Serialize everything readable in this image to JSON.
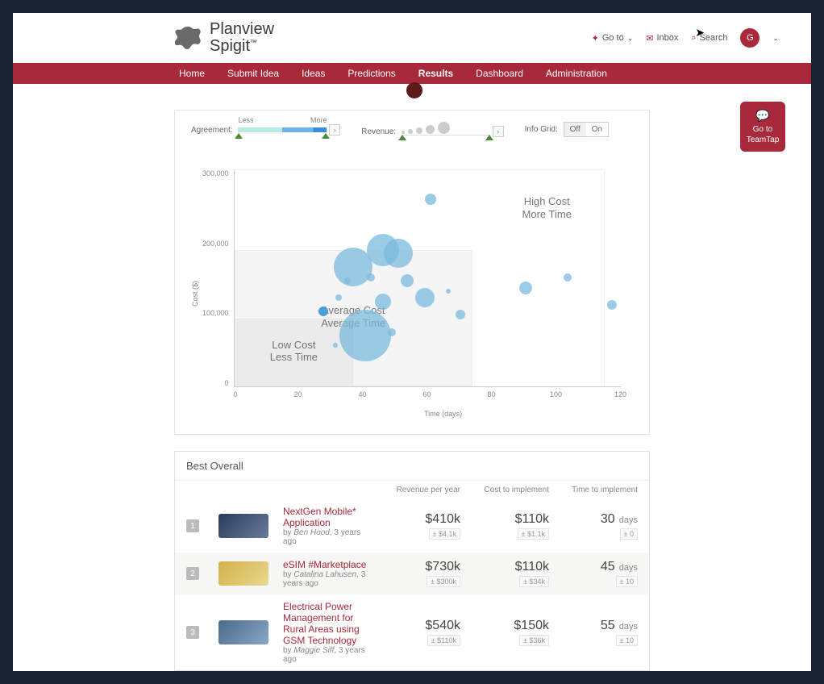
{
  "brand": {
    "line1": "Planview",
    "line2": "Spigit",
    "tm": "™"
  },
  "top": {
    "goto": "Go to",
    "inbox": "Inbox",
    "search": "Search",
    "avatar": "G"
  },
  "nav": {
    "items": [
      "Home",
      "Submit Idea",
      "Ideas",
      "Predictions",
      "Results",
      "Dashboard",
      "Administration"
    ],
    "active": 4
  },
  "controls": {
    "agreement_label": "Agreement:",
    "agreement_less": "Less",
    "agreement_more": "More",
    "revenue_label": "Revenue:",
    "infogrid_label": "Info Grid:",
    "off": "Off",
    "on": "On"
  },
  "side_button": {
    "line1": "Go to",
    "line2": "TeamTap"
  },
  "chart_data": {
    "type": "scatter",
    "xlabel": "Time (days)",
    "ylabel": "Cost ($)",
    "xlim": [
      0,
      130
    ],
    "ylim": [
      0,
      320000
    ],
    "x_ticks": [
      0,
      20,
      40,
      60,
      80,
      100,
      120
    ],
    "y_ticks": [
      0,
      100000,
      200000,
      300000
    ],
    "y_tick_labels": [
      "0",
      "100,000",
      "200,000",
      "300,000"
    ],
    "quadrants": [
      {
        "label": "Low Cost\nLess Time",
        "x0": 0,
        "x1": 40,
        "y0": 0,
        "y1": 100000
      },
      {
        "label": "Average Cost\nAverage Time",
        "x0": 0,
        "x1": 80,
        "y0": 0,
        "y1": 200000
      },
      {
        "label": "High Cost\nMore Time",
        "x0": 80,
        "x1": 130,
        "y0": 200000,
        "y1": 320000,
        "bg": false
      }
    ],
    "points": [
      {
        "x": 30,
        "y": 110000,
        "r": 6,
        "solid": true
      },
      {
        "x": 34,
        "y": 60000,
        "r": 3
      },
      {
        "x": 35,
        "y": 130000,
        "r": 4
      },
      {
        "x": 38,
        "y": 155000,
        "r": 4
      },
      {
        "x": 40,
        "y": 175000,
        "r": 24
      },
      {
        "x": 44,
        "y": 75000,
        "r": 32
      },
      {
        "x": 46,
        "y": 160000,
        "r": 5
      },
      {
        "x": 50,
        "y": 200000,
        "r": 20
      },
      {
        "x": 50,
        "y": 125000,
        "r": 10
      },
      {
        "x": 53,
        "y": 80000,
        "r": 5
      },
      {
        "x": 55,
        "y": 195000,
        "r": 18
      },
      {
        "x": 58,
        "y": 155000,
        "r": 8
      },
      {
        "x": 64,
        "y": 130000,
        "r": 12
      },
      {
        "x": 66,
        "y": 275000,
        "r": 7
      },
      {
        "x": 72,
        "y": 140000,
        "r": 3
      },
      {
        "x": 76,
        "y": 105000,
        "r": 6
      },
      {
        "x": 98,
        "y": 145000,
        "r": 8
      },
      {
        "x": 112,
        "y": 160000,
        "r": 5
      },
      {
        "x": 127,
        "y": 120000,
        "r": 6
      }
    ]
  },
  "results": {
    "title": "Best Overall",
    "cols": {
      "rev": "Revenue per year",
      "cost": "Cost to implement",
      "time": "Time to implement"
    },
    "rows": [
      {
        "rank": "1",
        "thumb_colors": [
          "#2a3a5a",
          "#6a7a9a"
        ],
        "title": "NextGen Mobile* Application",
        "author": "Ben Hood",
        "age": "3 years ago",
        "rev": "$410k",
        "rev_sub": "± $4.1k",
        "cost": "$110k",
        "cost_sub": "± $1.1k",
        "time": "30",
        "time_unit": "days",
        "time_sub": "± 0"
      },
      {
        "rank": "2",
        "thumb_colors": [
          "#d4b04a",
          "#e8d890"
        ],
        "title": "eSIM #Marketplace",
        "author": "Catalina Lahusen",
        "age": "3 years ago",
        "rev": "$730k",
        "rev_sub": "± $300k",
        "cost": "$110k",
        "cost_sub": "± $34k",
        "time": "45",
        "time_unit": "days",
        "time_sub": "± 10"
      },
      {
        "rank": "3",
        "thumb_colors": [
          "#4a6a8a",
          "#8aa8c8"
        ],
        "title": "Electrical Power Management for Rural Areas using GSM Technology",
        "author": "Maggie Siff",
        "age": "3 years ago",
        "rev": "$540k",
        "rev_sub": "± $110k",
        "cost": "$150k",
        "cost_sub": "± $36k",
        "time": "55",
        "time_unit": "days",
        "time_sub": "± 10"
      }
    ]
  }
}
